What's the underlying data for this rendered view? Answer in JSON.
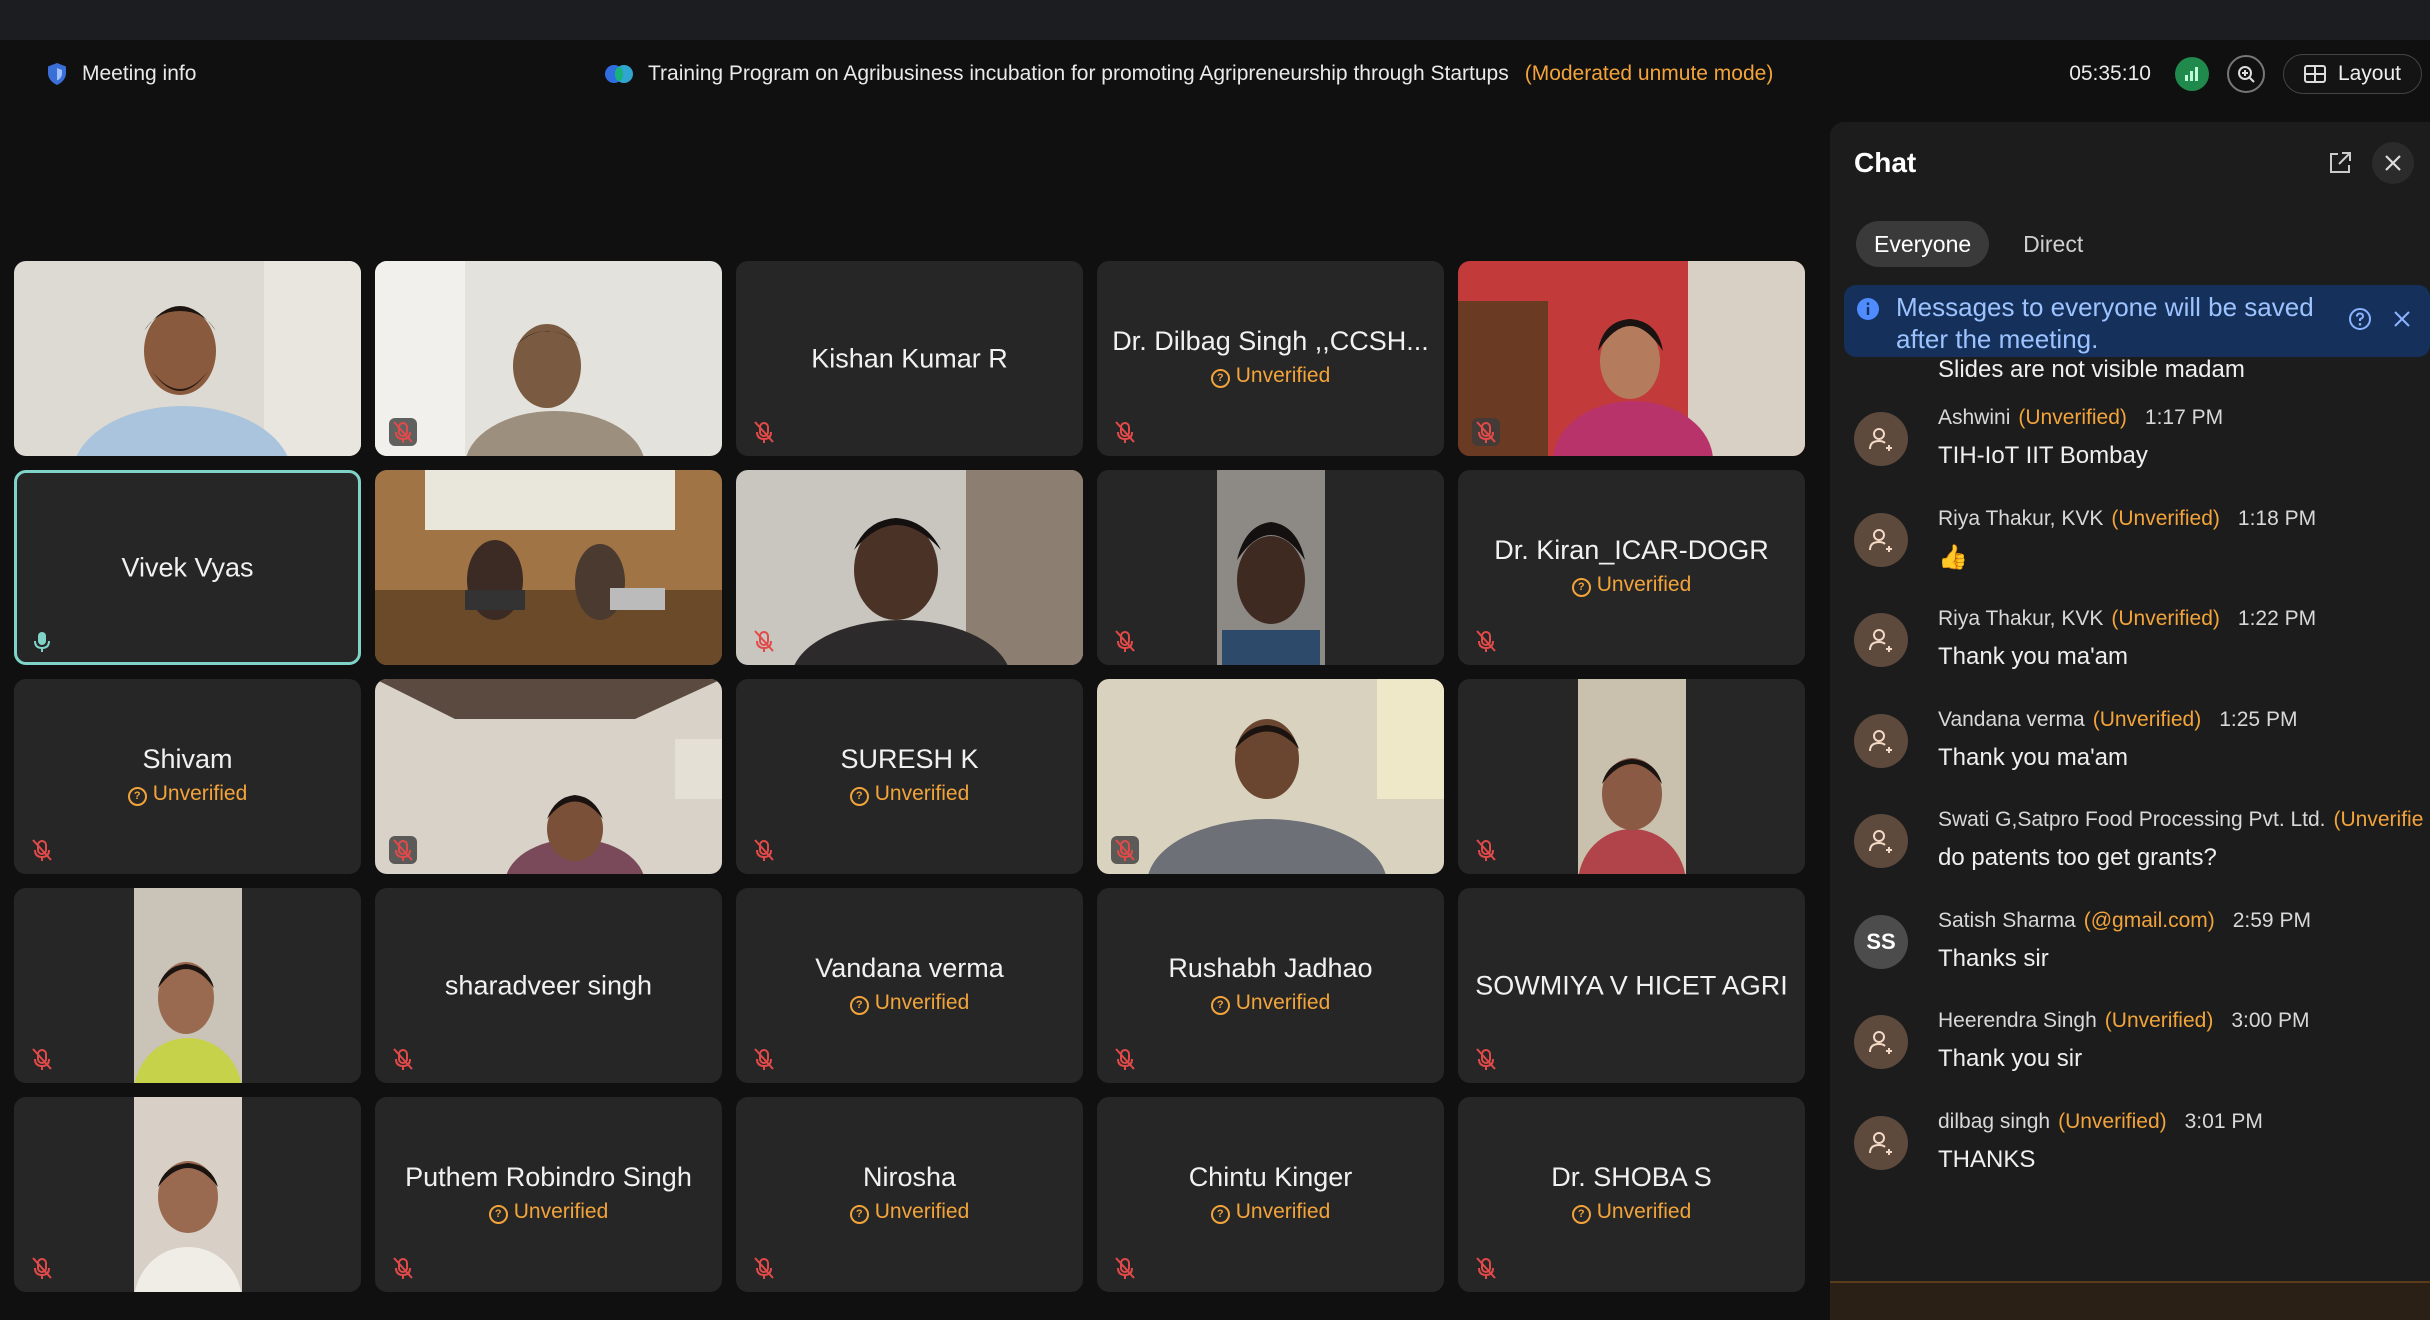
{
  "top": {
    "meeting_info_label": "Meeting info",
    "meeting_title": "Training Program on Agribusiness incubation for promoting Agripreneurship through Startups",
    "mode": "(Moderated unmute mode)",
    "timer": "05:35:10",
    "layout_label": "Layout"
  },
  "tiles": [
    {
      "name": "",
      "video": true
    },
    {
      "name": "",
      "video": true
    },
    {
      "name": "Kishan Kumar R",
      "unverified": ""
    },
    {
      "name": "Dr. Dilbag Singh ,,CCSH...",
      "unverified": "Unverified"
    },
    {
      "name": "",
      "video": true
    },
    {
      "name": "Vivek Vyas",
      "unverified": ""
    },
    {
      "name": "",
      "video": true
    },
    {
      "name": "",
      "video": true
    },
    {
      "name": "",
      "video": true
    },
    {
      "name": "Dr. Kiran_ICAR-DOGR",
      "unverified": "Unverified"
    },
    {
      "name": "Shivam",
      "unverified": "Unverified"
    },
    {
      "name": "",
      "video": true
    },
    {
      "name": "SURESH K",
      "unverified": "Unverified"
    },
    {
      "name": "",
      "video": true
    },
    {
      "name": "",
      "video": true
    },
    {
      "name": "",
      "video": true
    },
    {
      "name": "sharadveer singh",
      "unverified": ""
    },
    {
      "name": "Vandana verma",
      "unverified": "Unverified"
    },
    {
      "name": "Rushabh Jadhao",
      "unverified": "Unverified"
    },
    {
      "name": "SOWMIYA V HICET AGRI",
      "unverified": ""
    },
    {
      "name": "",
      "video": true
    },
    {
      "name": "Puthem Robindro Singh",
      "unverified": "Unverified"
    },
    {
      "name": "Nirosha",
      "unverified": "Unverified"
    },
    {
      "name": "Chintu Kinger",
      "unverified": "Unverified"
    },
    {
      "name": "Dr. SHOBA S",
      "unverified": "Unverified"
    }
  ],
  "chat": {
    "title": "Chat",
    "tabs": [
      "Everyone",
      "Direct"
    ],
    "banner": "Messages to everyone will be saved after the meeting.",
    "previous_text": "Slides are not visible madam",
    "messages": [
      {
        "sender": "Ashwini",
        "tag": "(Unverified)",
        "time": "1:17 PM",
        "text": "TIH-IoT IIT Bombay",
        "avatar": "person"
      },
      {
        "sender": "Riya Thakur, KVK",
        "tag": "(Unverified)",
        "time": "1:18 PM",
        "text": "👍",
        "avatar": "person"
      },
      {
        "sender": "Riya Thakur, KVK",
        "tag": "(Unverified)",
        "time": "1:22 PM",
        "text": "Thank you ma'am",
        "avatar": "person"
      },
      {
        "sender": "Vandana verma",
        "tag": "(Unverified)",
        "time": "1:25 PM",
        "text": "Thank you ma'am",
        "avatar": "person"
      },
      {
        "sender": "Swati G,Satpro Food Processing Pvt. Ltd.",
        "tag": "(Unverifie",
        "time": "",
        "text": "do patents too get grants?",
        "avatar": "person"
      },
      {
        "sender": "Satish Sharma",
        "tag": "(@gmail.com)",
        "time": "2:59 PM",
        "text": "Thanks sir",
        "avatar": "SS"
      },
      {
        "sender": "Heerendra Singh",
        "tag": "(Unverified)",
        "time": "3:00 PM",
        "text": "Thank you sir",
        "avatar": "person"
      },
      {
        "sender": "dilbag singh",
        "tag": "(Unverified)",
        "time": "3:01 PM",
        "text": "THANKS",
        "avatar": "person"
      }
    ]
  },
  "colors": {
    "accent_orange": "#f2a43a",
    "banner_bg": "#15305a",
    "active_outline": "#7fd3c8"
  }
}
